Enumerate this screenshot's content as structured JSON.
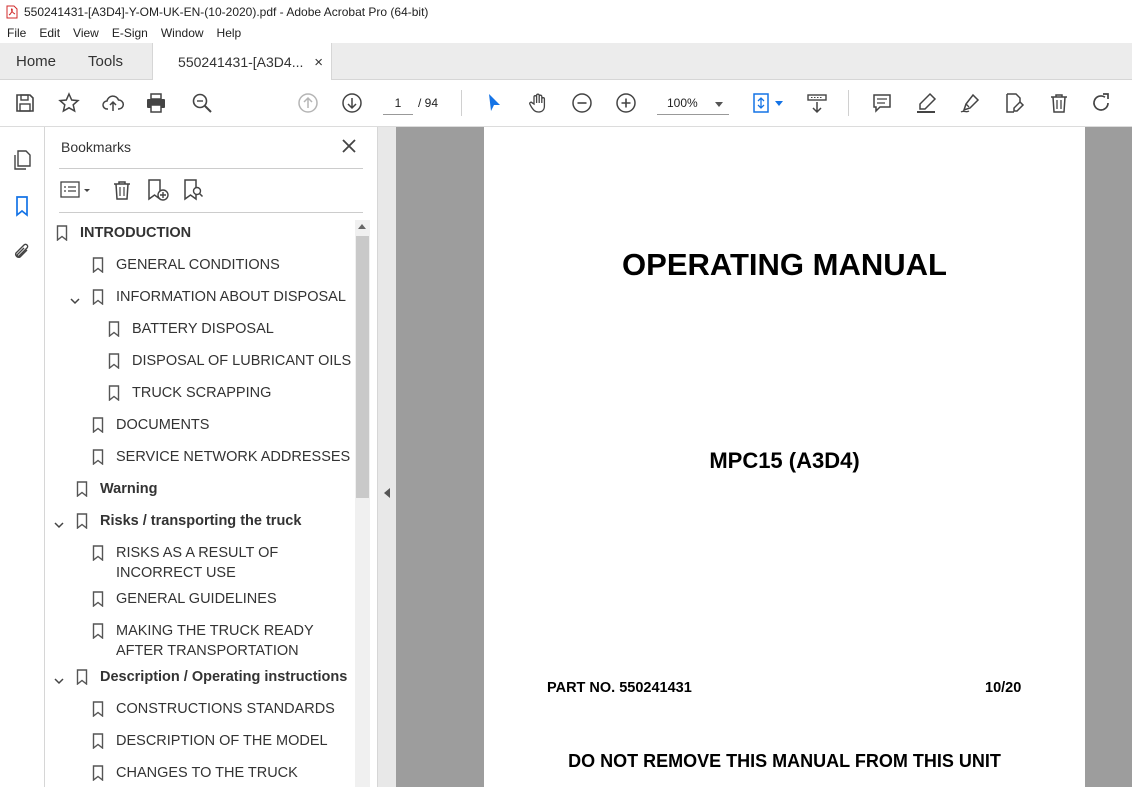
{
  "window": {
    "title": "550241431-[A3D4]-Y-OM-UK-EN-(10-2020).pdf - Adobe Acrobat Pro (64-bit)"
  },
  "menu": [
    "File",
    "Edit",
    "View",
    "E-Sign",
    "Window",
    "Help"
  ],
  "tabs": {
    "home": "Home",
    "tools": "Tools",
    "document": "550241431-[A3D4...",
    "close": "×"
  },
  "toolbar": {
    "page_current": "1",
    "page_total": "/ 94",
    "zoom": "100%"
  },
  "bookmarks": {
    "title": "Bookmarks",
    "items": [
      {
        "label": "INTRODUCTION",
        "bold": true
      },
      {
        "label": "GENERAL CONDITIONS"
      },
      {
        "label": "INFORMATION ABOUT DISPOSAL"
      },
      {
        "label": "BATTERY DISPOSAL"
      },
      {
        "label": "DISPOSAL OF LUBRICANT OILS"
      },
      {
        "label": "TRUCK SCRAPPING"
      },
      {
        "label": "DOCUMENTS"
      },
      {
        "label": "SERVICE NETWORK ADDRESSES"
      },
      {
        "label": "Warning",
        "bold": true
      },
      {
        "label": "Risks / transporting the truck",
        "bold": true
      },
      {
        "label": "RISKS AS A RESULT OF INCORRECT USE"
      },
      {
        "label": "GENERAL GUIDELINES"
      },
      {
        "label": "MAKING THE TRUCK READY AFTER TRANSPORTATION"
      },
      {
        "label": "Description / Operating instructions",
        "bold": true
      },
      {
        "label": "CONSTRUCTIONS STANDARDS"
      },
      {
        "label": "DESCRIPTION OF THE MODEL"
      },
      {
        "label": "CHANGES TO THE TRUCK"
      }
    ]
  },
  "document": {
    "title": "OPERATING MANUAL",
    "model": "MPC15 (A3D4)",
    "part_no": "PART NO. 550241431",
    "date": "10/20",
    "warning": "DO NOT REMOVE THIS MANUAL FROM THIS UNIT"
  }
}
